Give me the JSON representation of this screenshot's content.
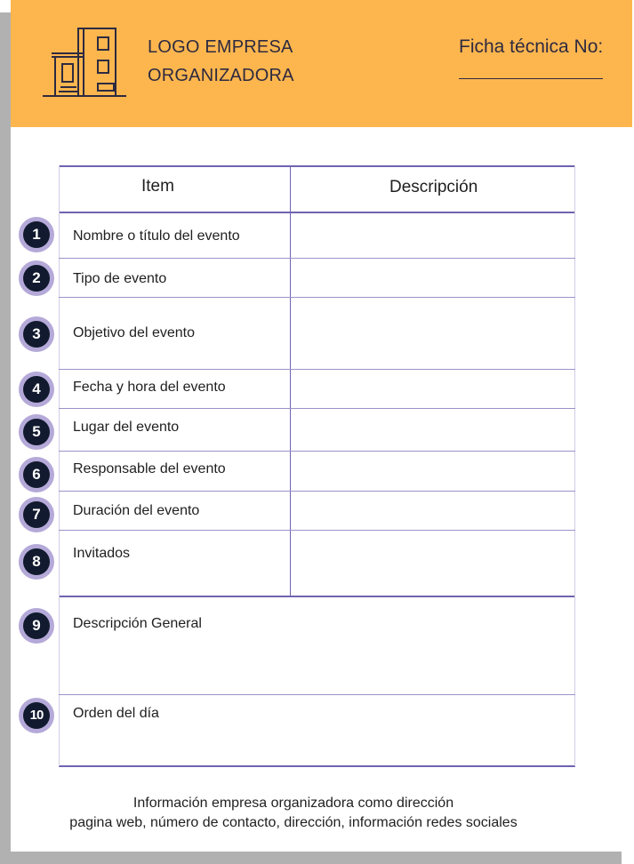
{
  "header": {
    "logo_line1": "LOGO EMPRESA",
    "logo_line2": "ORGANIZADORA",
    "ficha_label": "Ficha técnica No:"
  },
  "table": {
    "col_item": "Item",
    "col_descripcion": "Descripción",
    "rows": [
      {
        "number": "1",
        "label": "Nombre o título del evento"
      },
      {
        "number": "2",
        "label": "Tipo de evento"
      },
      {
        "number": "3",
        "label": "Objetivo del evento"
      },
      {
        "number": "4",
        "label": "Fecha y hora del evento"
      },
      {
        "number": "5",
        "label": "Lugar del evento"
      },
      {
        "number": "6",
        "label": "Responsable del evento"
      },
      {
        "number": "7",
        "label": "Duración del evento"
      },
      {
        "number": "8",
        "label": "Invitados"
      },
      {
        "number": "9",
        "label": "Descripción General"
      },
      {
        "number": "10",
        "label": "Orden del día"
      }
    ]
  },
  "footer": {
    "line1": "Información empresa organizadora como dirección",
    "line2": "pagina web, número de contacto, dirección, información redes sociales"
  },
  "colors": {
    "header_bg": "#FDB64E",
    "table_lines": "#6e63b0",
    "badge_ring": "#b4a9d8",
    "badge_fill": "#111a2e"
  }
}
